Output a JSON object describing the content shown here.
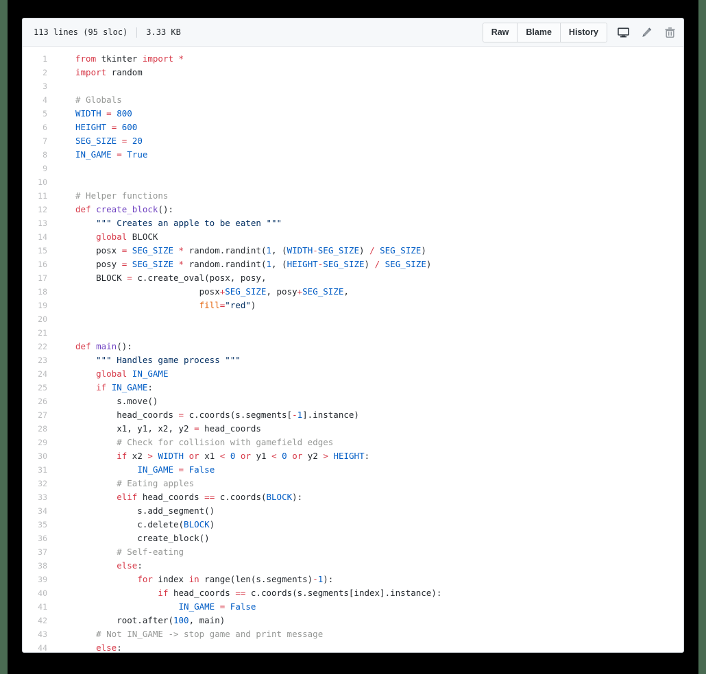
{
  "header": {
    "lines_info": "113 lines (95 sloc)",
    "file_size": "3.33 KB",
    "buttons": [
      {
        "label": "Raw",
        "name": "raw-button"
      },
      {
        "label": "Blame",
        "name": "blame-button"
      },
      {
        "label": "History",
        "name": "history-button"
      }
    ],
    "icons": [
      {
        "name": "desktop-icon",
        "title": "Open in desktop"
      },
      {
        "name": "pencil-icon",
        "title": "Edit this file"
      },
      {
        "name": "trash-icon",
        "title": "Delete this file"
      }
    ]
  },
  "code": {
    "language": "python",
    "lines": [
      {
        "n": "1",
        "tokens": [
          {
            "t": "kw",
            "v": "from"
          },
          {
            "t": "pln",
            "v": " tkinter "
          },
          {
            "t": "kw",
            "v": "import"
          },
          {
            "t": "pln",
            "v": " "
          },
          {
            "t": "kw",
            "v": "*"
          }
        ]
      },
      {
        "n": "2",
        "tokens": [
          {
            "t": "kw",
            "v": "import"
          },
          {
            "t": "pln",
            "v": " random"
          }
        ]
      },
      {
        "n": "3",
        "tokens": []
      },
      {
        "n": "4",
        "tokens": [
          {
            "t": "com",
            "v": "# Globals"
          }
        ]
      },
      {
        "n": "5",
        "tokens": [
          {
            "t": "const",
            "v": "WIDTH"
          },
          {
            "t": "pln",
            "v": " "
          },
          {
            "t": "op",
            "v": "="
          },
          {
            "t": "pln",
            "v": " "
          },
          {
            "t": "num",
            "v": "800"
          }
        ]
      },
      {
        "n": "6",
        "tokens": [
          {
            "t": "const",
            "v": "HEIGHT"
          },
          {
            "t": "pln",
            "v": " "
          },
          {
            "t": "op",
            "v": "="
          },
          {
            "t": "pln",
            "v": " "
          },
          {
            "t": "num",
            "v": "600"
          }
        ]
      },
      {
        "n": "7",
        "tokens": [
          {
            "t": "const",
            "v": "SEG_SIZE"
          },
          {
            "t": "pln",
            "v": " "
          },
          {
            "t": "op",
            "v": "="
          },
          {
            "t": "pln",
            "v": " "
          },
          {
            "t": "num",
            "v": "20"
          }
        ]
      },
      {
        "n": "8",
        "tokens": [
          {
            "t": "const",
            "v": "IN_GAME"
          },
          {
            "t": "pln",
            "v": " "
          },
          {
            "t": "op",
            "v": "="
          },
          {
            "t": "pln",
            "v": " "
          },
          {
            "t": "num",
            "v": "True"
          }
        ]
      },
      {
        "n": "9",
        "tokens": []
      },
      {
        "n": "10",
        "tokens": []
      },
      {
        "n": "11",
        "tokens": [
          {
            "t": "com",
            "v": "# Helper functions"
          }
        ]
      },
      {
        "n": "12",
        "tokens": [
          {
            "t": "kw",
            "v": "def"
          },
          {
            "t": "pln",
            "v": " "
          },
          {
            "t": "fn",
            "v": "create_block"
          },
          {
            "t": "pln",
            "v": "():"
          }
        ]
      },
      {
        "n": "13",
        "tokens": [
          {
            "t": "pln",
            "v": "    "
          },
          {
            "t": "str",
            "v": "\"\"\" Creates an apple to be eaten \"\"\""
          }
        ]
      },
      {
        "n": "14",
        "tokens": [
          {
            "t": "pln",
            "v": "    "
          },
          {
            "t": "kw",
            "v": "global"
          },
          {
            "t": "pln",
            "v": " BLOCK"
          }
        ]
      },
      {
        "n": "15",
        "tokens": [
          {
            "t": "pln",
            "v": "    posx "
          },
          {
            "t": "op",
            "v": "="
          },
          {
            "t": "pln",
            "v": " "
          },
          {
            "t": "const",
            "v": "SEG_SIZE"
          },
          {
            "t": "pln",
            "v": " "
          },
          {
            "t": "op",
            "v": "*"
          },
          {
            "t": "pln",
            "v": " random.randint("
          },
          {
            "t": "num",
            "v": "1"
          },
          {
            "t": "pln",
            "v": ", ("
          },
          {
            "t": "const",
            "v": "WIDTH"
          },
          {
            "t": "op",
            "v": "-"
          },
          {
            "t": "const",
            "v": "SEG_SIZE"
          },
          {
            "t": "pln",
            "v": ") "
          },
          {
            "t": "op",
            "v": "/"
          },
          {
            "t": "pln",
            "v": " "
          },
          {
            "t": "const",
            "v": "SEG_SIZE"
          },
          {
            "t": "pln",
            "v": ")"
          }
        ]
      },
      {
        "n": "16",
        "tokens": [
          {
            "t": "pln",
            "v": "    posy "
          },
          {
            "t": "op",
            "v": "="
          },
          {
            "t": "pln",
            "v": " "
          },
          {
            "t": "const",
            "v": "SEG_SIZE"
          },
          {
            "t": "pln",
            "v": " "
          },
          {
            "t": "op",
            "v": "*"
          },
          {
            "t": "pln",
            "v": " random.randint("
          },
          {
            "t": "num",
            "v": "1"
          },
          {
            "t": "pln",
            "v": ", ("
          },
          {
            "t": "const",
            "v": "HEIGHT"
          },
          {
            "t": "op",
            "v": "-"
          },
          {
            "t": "const",
            "v": "SEG_SIZE"
          },
          {
            "t": "pln",
            "v": ") "
          },
          {
            "t": "op",
            "v": "/"
          },
          {
            "t": "pln",
            "v": " "
          },
          {
            "t": "const",
            "v": "SEG_SIZE"
          },
          {
            "t": "pln",
            "v": ")"
          }
        ]
      },
      {
        "n": "17",
        "tokens": [
          {
            "t": "pln",
            "v": "    BLOCK "
          },
          {
            "t": "op",
            "v": "="
          },
          {
            "t": "pln",
            "v": " c.create_oval(posx, posy,"
          }
        ]
      },
      {
        "n": "18",
        "tokens": [
          {
            "t": "pln",
            "v": "                        posx"
          },
          {
            "t": "op",
            "v": "+"
          },
          {
            "t": "const",
            "v": "SEG_SIZE"
          },
          {
            "t": "pln",
            "v": ", posy"
          },
          {
            "t": "op",
            "v": "+"
          },
          {
            "t": "const",
            "v": "SEG_SIZE"
          },
          {
            "t": "pln",
            "v": ","
          }
        ]
      },
      {
        "n": "19",
        "tokens": [
          {
            "t": "pln",
            "v": "                        "
          },
          {
            "t": "kwarg",
            "v": "fill"
          },
          {
            "t": "op",
            "v": "="
          },
          {
            "t": "str",
            "v": "\"red\""
          },
          {
            "t": "pln",
            "v": ")"
          }
        ]
      },
      {
        "n": "20",
        "tokens": []
      },
      {
        "n": "21",
        "tokens": []
      },
      {
        "n": "22",
        "tokens": [
          {
            "t": "kw",
            "v": "def"
          },
          {
            "t": "pln",
            "v": " "
          },
          {
            "t": "fn",
            "v": "main"
          },
          {
            "t": "pln",
            "v": "():"
          }
        ]
      },
      {
        "n": "23",
        "tokens": [
          {
            "t": "pln",
            "v": "    "
          },
          {
            "t": "str",
            "v": "\"\"\" Handles game process \"\"\""
          }
        ]
      },
      {
        "n": "24",
        "tokens": [
          {
            "t": "pln",
            "v": "    "
          },
          {
            "t": "kw",
            "v": "global"
          },
          {
            "t": "pln",
            "v": " "
          },
          {
            "t": "const",
            "v": "IN_GAME"
          }
        ]
      },
      {
        "n": "25",
        "tokens": [
          {
            "t": "pln",
            "v": "    "
          },
          {
            "t": "kw",
            "v": "if"
          },
          {
            "t": "pln",
            "v": " "
          },
          {
            "t": "const",
            "v": "IN_GAME"
          },
          {
            "t": "pln",
            "v": ":"
          }
        ]
      },
      {
        "n": "26",
        "tokens": [
          {
            "t": "pln",
            "v": "        s.move()"
          }
        ]
      },
      {
        "n": "27",
        "tokens": [
          {
            "t": "pln",
            "v": "        head_coords "
          },
          {
            "t": "op",
            "v": "="
          },
          {
            "t": "pln",
            "v": " c.coords(s.segments["
          },
          {
            "t": "op",
            "v": "-"
          },
          {
            "t": "num",
            "v": "1"
          },
          {
            "t": "pln",
            "v": "].instance)"
          }
        ]
      },
      {
        "n": "28",
        "tokens": [
          {
            "t": "pln",
            "v": "        x1, y1, x2, y2 "
          },
          {
            "t": "op",
            "v": "="
          },
          {
            "t": "pln",
            "v": " head_coords"
          }
        ]
      },
      {
        "n": "29",
        "tokens": [
          {
            "t": "pln",
            "v": "        "
          },
          {
            "t": "com",
            "v": "# Check for collision with gamefield edges"
          }
        ]
      },
      {
        "n": "30",
        "tokens": [
          {
            "t": "pln",
            "v": "        "
          },
          {
            "t": "kw",
            "v": "if"
          },
          {
            "t": "pln",
            "v": " x2 "
          },
          {
            "t": "op",
            "v": ">"
          },
          {
            "t": "pln",
            "v": " "
          },
          {
            "t": "const",
            "v": "WIDTH"
          },
          {
            "t": "pln",
            "v": " "
          },
          {
            "t": "kw",
            "v": "or"
          },
          {
            "t": "pln",
            "v": " x1 "
          },
          {
            "t": "op",
            "v": "<"
          },
          {
            "t": "pln",
            "v": " "
          },
          {
            "t": "num",
            "v": "0"
          },
          {
            "t": "pln",
            "v": " "
          },
          {
            "t": "kw",
            "v": "or"
          },
          {
            "t": "pln",
            "v": " y1 "
          },
          {
            "t": "op",
            "v": "<"
          },
          {
            "t": "pln",
            "v": " "
          },
          {
            "t": "num",
            "v": "0"
          },
          {
            "t": "pln",
            "v": " "
          },
          {
            "t": "kw",
            "v": "or"
          },
          {
            "t": "pln",
            "v": " y2 "
          },
          {
            "t": "op",
            "v": ">"
          },
          {
            "t": "pln",
            "v": " "
          },
          {
            "t": "const",
            "v": "HEIGHT"
          },
          {
            "t": "pln",
            "v": ":"
          }
        ]
      },
      {
        "n": "31",
        "tokens": [
          {
            "t": "pln",
            "v": "            "
          },
          {
            "t": "const",
            "v": "IN_GAME"
          },
          {
            "t": "pln",
            "v": " "
          },
          {
            "t": "op",
            "v": "="
          },
          {
            "t": "pln",
            "v": " "
          },
          {
            "t": "num",
            "v": "False"
          }
        ]
      },
      {
        "n": "32",
        "tokens": [
          {
            "t": "pln",
            "v": "        "
          },
          {
            "t": "com",
            "v": "# Eating apples"
          }
        ]
      },
      {
        "n": "33",
        "tokens": [
          {
            "t": "pln",
            "v": "        "
          },
          {
            "t": "kw",
            "v": "elif"
          },
          {
            "t": "pln",
            "v": " head_coords "
          },
          {
            "t": "op",
            "v": "=="
          },
          {
            "t": "pln",
            "v": " c.coords("
          },
          {
            "t": "const",
            "v": "BLOCK"
          },
          {
            "t": "pln",
            "v": "):"
          }
        ]
      },
      {
        "n": "34",
        "tokens": [
          {
            "t": "pln",
            "v": "            s.add_segment()"
          }
        ]
      },
      {
        "n": "35",
        "tokens": [
          {
            "t": "pln",
            "v": "            c.delete("
          },
          {
            "t": "const",
            "v": "BLOCK"
          },
          {
            "t": "pln",
            "v": ")"
          }
        ]
      },
      {
        "n": "36",
        "tokens": [
          {
            "t": "pln",
            "v": "            create_block()"
          }
        ]
      },
      {
        "n": "37",
        "tokens": [
          {
            "t": "pln",
            "v": "        "
          },
          {
            "t": "com",
            "v": "# Self-eating"
          }
        ]
      },
      {
        "n": "38",
        "tokens": [
          {
            "t": "pln",
            "v": "        "
          },
          {
            "t": "kw",
            "v": "else"
          },
          {
            "t": "pln",
            "v": ":"
          }
        ]
      },
      {
        "n": "39",
        "tokens": [
          {
            "t": "pln",
            "v": "            "
          },
          {
            "t": "kw",
            "v": "for"
          },
          {
            "t": "pln",
            "v": " index "
          },
          {
            "t": "kw",
            "v": "in"
          },
          {
            "t": "pln",
            "v": " range("
          },
          {
            "t": "pln",
            "v": "len(s.segments)"
          },
          {
            "t": "op",
            "v": "-"
          },
          {
            "t": "num",
            "v": "1"
          },
          {
            "t": "pln",
            "v": "):"
          }
        ]
      },
      {
        "n": "40",
        "tokens": [
          {
            "t": "pln",
            "v": "                "
          },
          {
            "t": "kw",
            "v": "if"
          },
          {
            "t": "pln",
            "v": " head_coords "
          },
          {
            "t": "op",
            "v": "=="
          },
          {
            "t": "pln",
            "v": " c.coords(s.segments[index].instance):"
          }
        ]
      },
      {
        "n": "41",
        "tokens": [
          {
            "t": "pln",
            "v": "                    "
          },
          {
            "t": "const",
            "v": "IN_GAME"
          },
          {
            "t": "pln",
            "v": " "
          },
          {
            "t": "op",
            "v": "="
          },
          {
            "t": "pln",
            "v": " "
          },
          {
            "t": "num",
            "v": "False"
          }
        ]
      },
      {
        "n": "42",
        "tokens": [
          {
            "t": "pln",
            "v": "        root.after("
          },
          {
            "t": "num",
            "v": "100"
          },
          {
            "t": "pln",
            "v": ", main)"
          }
        ]
      },
      {
        "n": "43",
        "tokens": [
          {
            "t": "pln",
            "v": "    "
          },
          {
            "t": "com",
            "v": "# Not IN_GAME -> stop game and print message"
          }
        ]
      },
      {
        "n": "44",
        "tokens": [
          {
            "t": "pln",
            "v": "    "
          },
          {
            "t": "kw",
            "v": "else"
          },
          {
            "t": "pln",
            "v": ":"
          }
        ]
      }
    ]
  },
  "colors": {
    "keyword": "#d73a49",
    "comment": "#969896",
    "string": "#032f62",
    "number": "#005cc5",
    "constant": "#005cc5",
    "function": "#6f42c1",
    "kwarg": "#e36209",
    "plain": "#24292e",
    "header_bg": "#f6f8fa",
    "card_bg": "#ffffff",
    "page_bg": "#000000",
    "edge": "#4a6b52"
  }
}
